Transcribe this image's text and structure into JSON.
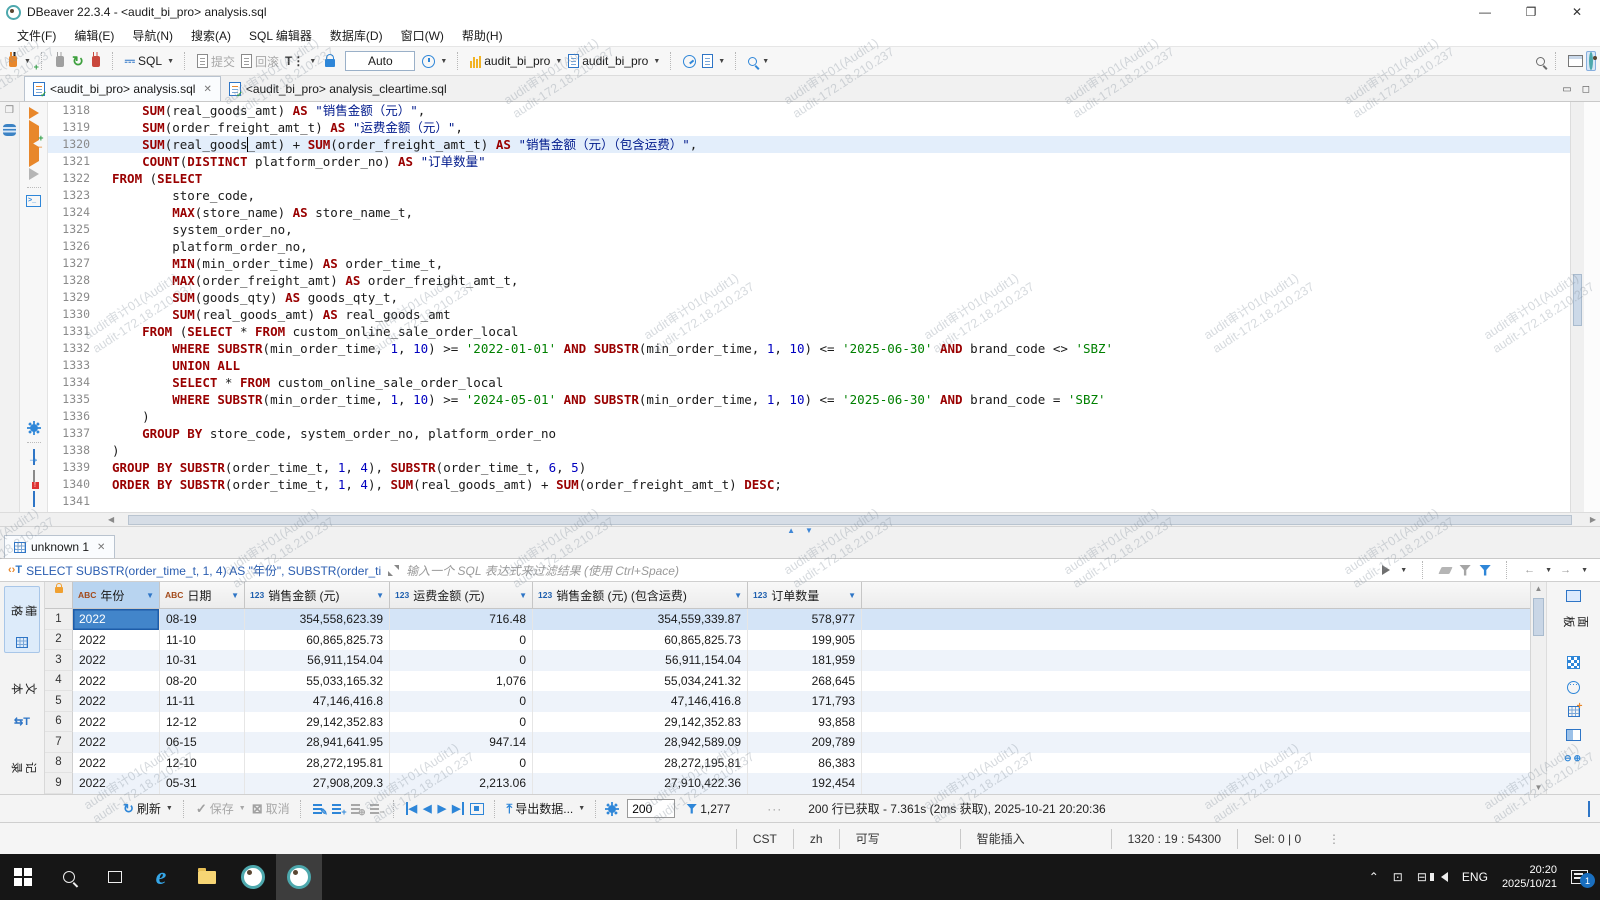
{
  "window": {
    "title": "DBeaver 22.3.4 - <audit_bi_pro> analysis.sql"
  },
  "menu": {
    "items": [
      "文件(F)",
      "编辑(E)",
      "导航(N)",
      "搜索(A)",
      "SQL 编辑器",
      "数据库(D)",
      "窗口(W)",
      "帮助(H)"
    ]
  },
  "toolbar": {
    "sql_label": "SQL",
    "commit_label": "提交",
    "rollback_label": "回滚",
    "auto_label": "Auto",
    "connection_name": "audit_bi_pro",
    "database_name": "audit_bi_pro"
  },
  "editor_tabs": {
    "tab1": "<audit_bi_pro> analysis.sql",
    "tab2": "<audit_bi_pro> analysis_cleartime.sql"
  },
  "editor": {
    "caret": {
      "line": 1320,
      "col": 19
    },
    "lines": [
      {
        "no": 1318,
        "text": "    SUM(real_goods_amt) AS \"销售金额（元）\","
      },
      {
        "no": 1319,
        "text": "    SUM(order_freight_amt_t) AS \"运费金额（元）\","
      },
      {
        "no": 1320,
        "text": "    SUM(real_goods_amt) + SUM(order_freight_amt_t) AS \"销售金额（元）（包含运费）\","
      },
      {
        "no": 1321,
        "text": "    COUNT(DISTINCT platform_order_no) AS \"订单数量\""
      },
      {
        "no": 1322,
        "text": "FROM (SELECT"
      },
      {
        "no": 1323,
        "text": "        store_code,"
      },
      {
        "no": 1324,
        "text": "        MAX(store_name) AS store_name_t,"
      },
      {
        "no": 1325,
        "text": "        system_order_no,"
      },
      {
        "no": 1326,
        "text": "        platform_order_no,"
      },
      {
        "no": 1327,
        "text": "        MIN(min_order_time) AS order_time_t,"
      },
      {
        "no": 1328,
        "text": "        MAX(order_freight_amt) AS order_freight_amt_t,"
      },
      {
        "no": 1329,
        "text": "        SUM(goods_qty) AS goods_qty_t,"
      },
      {
        "no": 1330,
        "text": "        SUM(real_goods_amt) AS real_goods_amt"
      },
      {
        "no": 1331,
        "text": "    FROM (SELECT * FROM custom_online_sale_order_local"
      },
      {
        "no": 1332,
        "text": "        WHERE SUBSTR(min_order_time, 1, 10) >= '2022-01-01' AND SUBSTR(min_order_time, 1, 10) <= '2025-06-30' AND brand_code <> 'SBZ'"
      },
      {
        "no": 1333,
        "text": "        UNION ALL"
      },
      {
        "no": 1334,
        "text": "        SELECT * FROM custom_online_sale_order_local"
      },
      {
        "no": 1335,
        "text": "        WHERE SUBSTR(min_order_time, 1, 10) >= '2024-05-01' AND SUBSTR(min_order_time, 1, 10) <= '2025-06-30' AND brand_code = 'SBZ'"
      },
      {
        "no": 1336,
        "text": "    )"
      },
      {
        "no": 1337,
        "text": "    GROUP BY store_code, system_order_no, platform_order_no"
      },
      {
        "no": 1338,
        "text": ")"
      },
      {
        "no": 1339,
        "text": "GROUP BY SUBSTR(order_time_t, 1, 4), SUBSTR(order_time_t, 6, 5)"
      },
      {
        "no": 1340,
        "text": "ORDER BY SUBSTR(order_time_t, 1, 4), SUM(real_goods_amt) + SUM(order_freight_amt_t) DESC;"
      },
      {
        "no": 1341,
        "text": ""
      }
    ]
  },
  "results": {
    "tab_label": "unknown 1",
    "filter_expr": "SELECT SUBSTR(order_time_t, 1, 4) AS \"年份\", SUBSTR(order_ti",
    "filter_placeholder": "输入一个 SQL 表达式来过滤结果 (使用 Ctrl+Space)",
    "side_tabs": {
      "grid": "栅格",
      "text": "文本",
      "record": "记录"
    },
    "panel_label": "面板",
    "grid": {
      "columns": [
        {
          "type": "ABC",
          "label": "年份"
        },
        {
          "type": "ABC",
          "label": "日期"
        },
        {
          "type": "123",
          "label": "销售金额 (元)"
        },
        {
          "type": "123",
          "label": "运费金额 (元)"
        },
        {
          "type": "123",
          "label": "销售金额 (元) (包含运费)"
        },
        {
          "type": "123",
          "label": "订单数量"
        }
      ],
      "rows": [
        {
          "num": "1",
          "cells": [
            "2022",
            "08-19",
            "354,558,623.39",
            "716.48",
            "354,559,339.87",
            "578,977"
          ]
        },
        {
          "num": "2",
          "cells": [
            "2022",
            "11-10",
            "60,865,825.73",
            "0",
            "60,865,825.73",
            "199,905"
          ]
        },
        {
          "num": "3",
          "cells": [
            "2022",
            "10-31",
            "56,911,154.04",
            "0",
            "56,911,154.04",
            "181,959"
          ]
        },
        {
          "num": "4",
          "cells": [
            "2022",
            "08-20",
            "55,033,165.32",
            "1,076",
            "55,034,241.32",
            "268,645"
          ]
        },
        {
          "num": "5",
          "cells": [
            "2022",
            "11-11",
            "47,146,416.8",
            "0",
            "47,146,416.8",
            "171,793"
          ]
        },
        {
          "num": "6",
          "cells": [
            "2022",
            "12-12",
            "29,142,352.83",
            "0",
            "29,142,352.83",
            "93,858"
          ]
        },
        {
          "num": "7",
          "cells": [
            "2022",
            "06-15",
            "28,941,641.95",
            "947.14",
            "28,942,589.09",
            "209,789"
          ]
        },
        {
          "num": "8",
          "cells": [
            "2022",
            "12-10",
            "28,272,195.81",
            "0",
            "28,272,195.81",
            "86,383"
          ]
        },
        {
          "num": "9",
          "cells": [
            "2022",
            "05-31",
            "27,908,209.3",
            "2,213.06",
            "27,910,422.36",
            "192,454"
          ]
        }
      ]
    },
    "toolbar": {
      "refresh": "刷新",
      "save": "保存",
      "cancel": "取消",
      "export": "导出数据...",
      "fetch_size": "200",
      "row_count": "1,277",
      "status": "200 行已获取 - 7.361s (2ms 获取), 2025-10-21 20:20:36"
    }
  },
  "statusbar": {
    "items": [
      "CST",
      "zh",
      "可写",
      "智能插入",
      "1320 : 19 : 54300",
      "Sel: 0 | 0"
    ]
  },
  "taskbar": {
    "lang": "ENG",
    "time": "20:20",
    "date": "2025/10/21",
    "notification_count": "1"
  },
  "watermark": {
    "line1": "audit审计01(Audit1)",
    "line2": "audit-172.18.210.237"
  },
  "colors": {
    "accent_blue": "#2e75c6",
    "selection_blue": "#4285ca",
    "keyword_red": "#990000",
    "string_green": "#008000",
    "number_blue": "#0000c0",
    "quoted_identifier_navy": "#001a8c",
    "current_line_bg": "#e3eefb",
    "taskbar_bg": "#161616"
  }
}
